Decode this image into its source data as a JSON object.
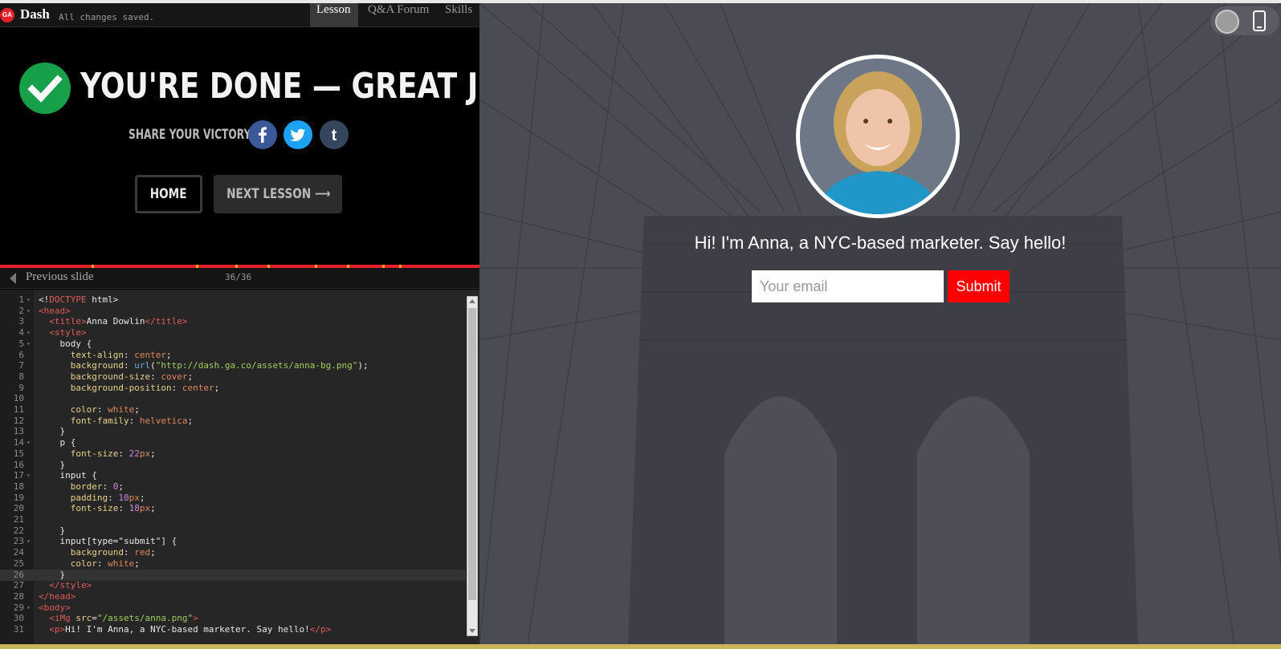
{
  "app": {
    "logo_text": "GA",
    "name": "Dash",
    "save_status": "All changes saved.",
    "tabs": [
      {
        "label": "Lesson",
        "active": true
      },
      {
        "label": "Q&A Forum",
        "active": false
      },
      {
        "label": "Skills",
        "active": false
      }
    ]
  },
  "completion": {
    "headline": "YOU'RE DONE — GREAT JOB!",
    "share_label": "SHARE YOUR VICTORY:",
    "social_icons": [
      "facebook-icon",
      "twitter-icon",
      "tumblr-icon"
    ],
    "home_label": "HOME",
    "next_label": "NEXT LESSON ⟶",
    "accent_color": "#17a049"
  },
  "slides": {
    "previous_label": "Previous slide",
    "counter": "36/36"
  },
  "editor": {
    "lines": [
      {
        "n": "1",
        "fold": "▾",
        "html": "&lt;!<span class=\"t\">DOCTYPE</span> html&gt;"
      },
      {
        "n": "2",
        "fold": "▾",
        "html": "<span class=\"t\">&lt;head&gt;</span>"
      },
      {
        "n": "3",
        "fold": "",
        "html": "  <span class=\"t\">&lt;title&gt;</span>Anna Dowlin<span class=\"t\">&lt;/title&gt;</span>"
      },
      {
        "n": "4",
        "fold": "▾",
        "html": "  <span class=\"t\">&lt;style&gt;</span>"
      },
      {
        "n": "5",
        "fold": "▾",
        "html": "    body {"
      },
      {
        "n": "6",
        "fold": "",
        "html": "      <span class=\"k\">text-align</span>: <span class=\"v\">center</span>;"
      },
      {
        "n": "7",
        "fold": "",
        "html": "      <span class=\"k\">background</span>: <span class=\"c\">url</span>(<span class=\"s\">\"http://dash.ga.co/assets/anna-bg.png\"</span>);"
      },
      {
        "n": "8",
        "fold": "",
        "html": "      <span class=\"k\">background-size</span>: <span class=\"v\">cover</span>;"
      },
      {
        "n": "9",
        "fold": "",
        "html": "      <span class=\"k\">background-position</span>: <span class=\"v\">center</span>;"
      },
      {
        "n": "10",
        "fold": "",
        "html": ""
      },
      {
        "n": "11",
        "fold": "",
        "html": "      <span class=\"k\">color</span>: <span class=\"v\">white</span>;"
      },
      {
        "n": "12",
        "fold": "",
        "html": "      <span class=\"k\">font-family</span>: <span class=\"v\">helvetica</span>;"
      },
      {
        "n": "13",
        "fold": "",
        "html": "    }"
      },
      {
        "n": "14",
        "fold": "▾",
        "html": "    p {"
      },
      {
        "n": "15",
        "fold": "",
        "html": "      <span class=\"k\">font-size</span>: <span class=\"n\">22</span><span class=\"v\">px</span>;"
      },
      {
        "n": "16",
        "fold": "",
        "html": "    }"
      },
      {
        "n": "17",
        "fold": "▾",
        "html": "    input {"
      },
      {
        "n": "18",
        "fold": "",
        "html": "      <span class=\"k\">border</span>: <span class=\"n\">0</span>;"
      },
      {
        "n": "19",
        "fold": "",
        "html": "      <span class=\"k\">padding</span>: <span class=\"n\">10</span><span class=\"v\">px</span>;"
      },
      {
        "n": "20",
        "fold": "",
        "html": "      <span class=\"k\">font-size</span>: <span class=\"n\">18</span><span class=\"v\">px</span>;"
      },
      {
        "n": "21",
        "fold": "",
        "html": ""
      },
      {
        "n": "22",
        "fold": "",
        "html": "    }"
      },
      {
        "n": "23",
        "fold": "▾",
        "html": "    input[type=\"submit\"] {"
      },
      {
        "n": "24",
        "fold": "",
        "html": "      <span class=\"k\">background</span>: <span class=\"v\">red</span>;"
      },
      {
        "n": "25",
        "fold": "",
        "html": "      <span class=\"k\">color</span>: <span class=\"v\">white</span>;"
      },
      {
        "n": "26",
        "fold": "",
        "html": "    }"
      },
      {
        "n": "27",
        "fold": "",
        "html": "  <span class=\"t\">&lt;/style&gt;</span>"
      },
      {
        "n": "28",
        "fold": "",
        "html": "<span class=\"t\">&lt;/head&gt;</span>"
      },
      {
        "n": "29",
        "fold": "▾",
        "html": "<span class=\"t\">&lt;body&gt;</span>"
      },
      {
        "n": "30",
        "fold": "",
        "html": "  <span class=\"t\">&lt;iMg</span> <span class=\"k\">src</span>=<span class=\"s\">\"/assets/anna.png\"</span><span class=\"t\">&gt;</span>"
      },
      {
        "n": "31",
        "fold": "",
        "html": "  <span class=\"t\">&lt;p&gt;</span>Hi! I'm Anna, a NYC-based marketer. Say hello!<span class=\"t\">&lt;/p&gt;</span>"
      }
    ],
    "current_line": "26"
  },
  "preview": {
    "intro_text": "Hi! I'm Anna, a NYC-based marketer. Say hello!",
    "email_placeholder": "Your email",
    "submit_label": "Submit",
    "submit_color": "#ff0000",
    "background_color": "#4a4b55"
  }
}
